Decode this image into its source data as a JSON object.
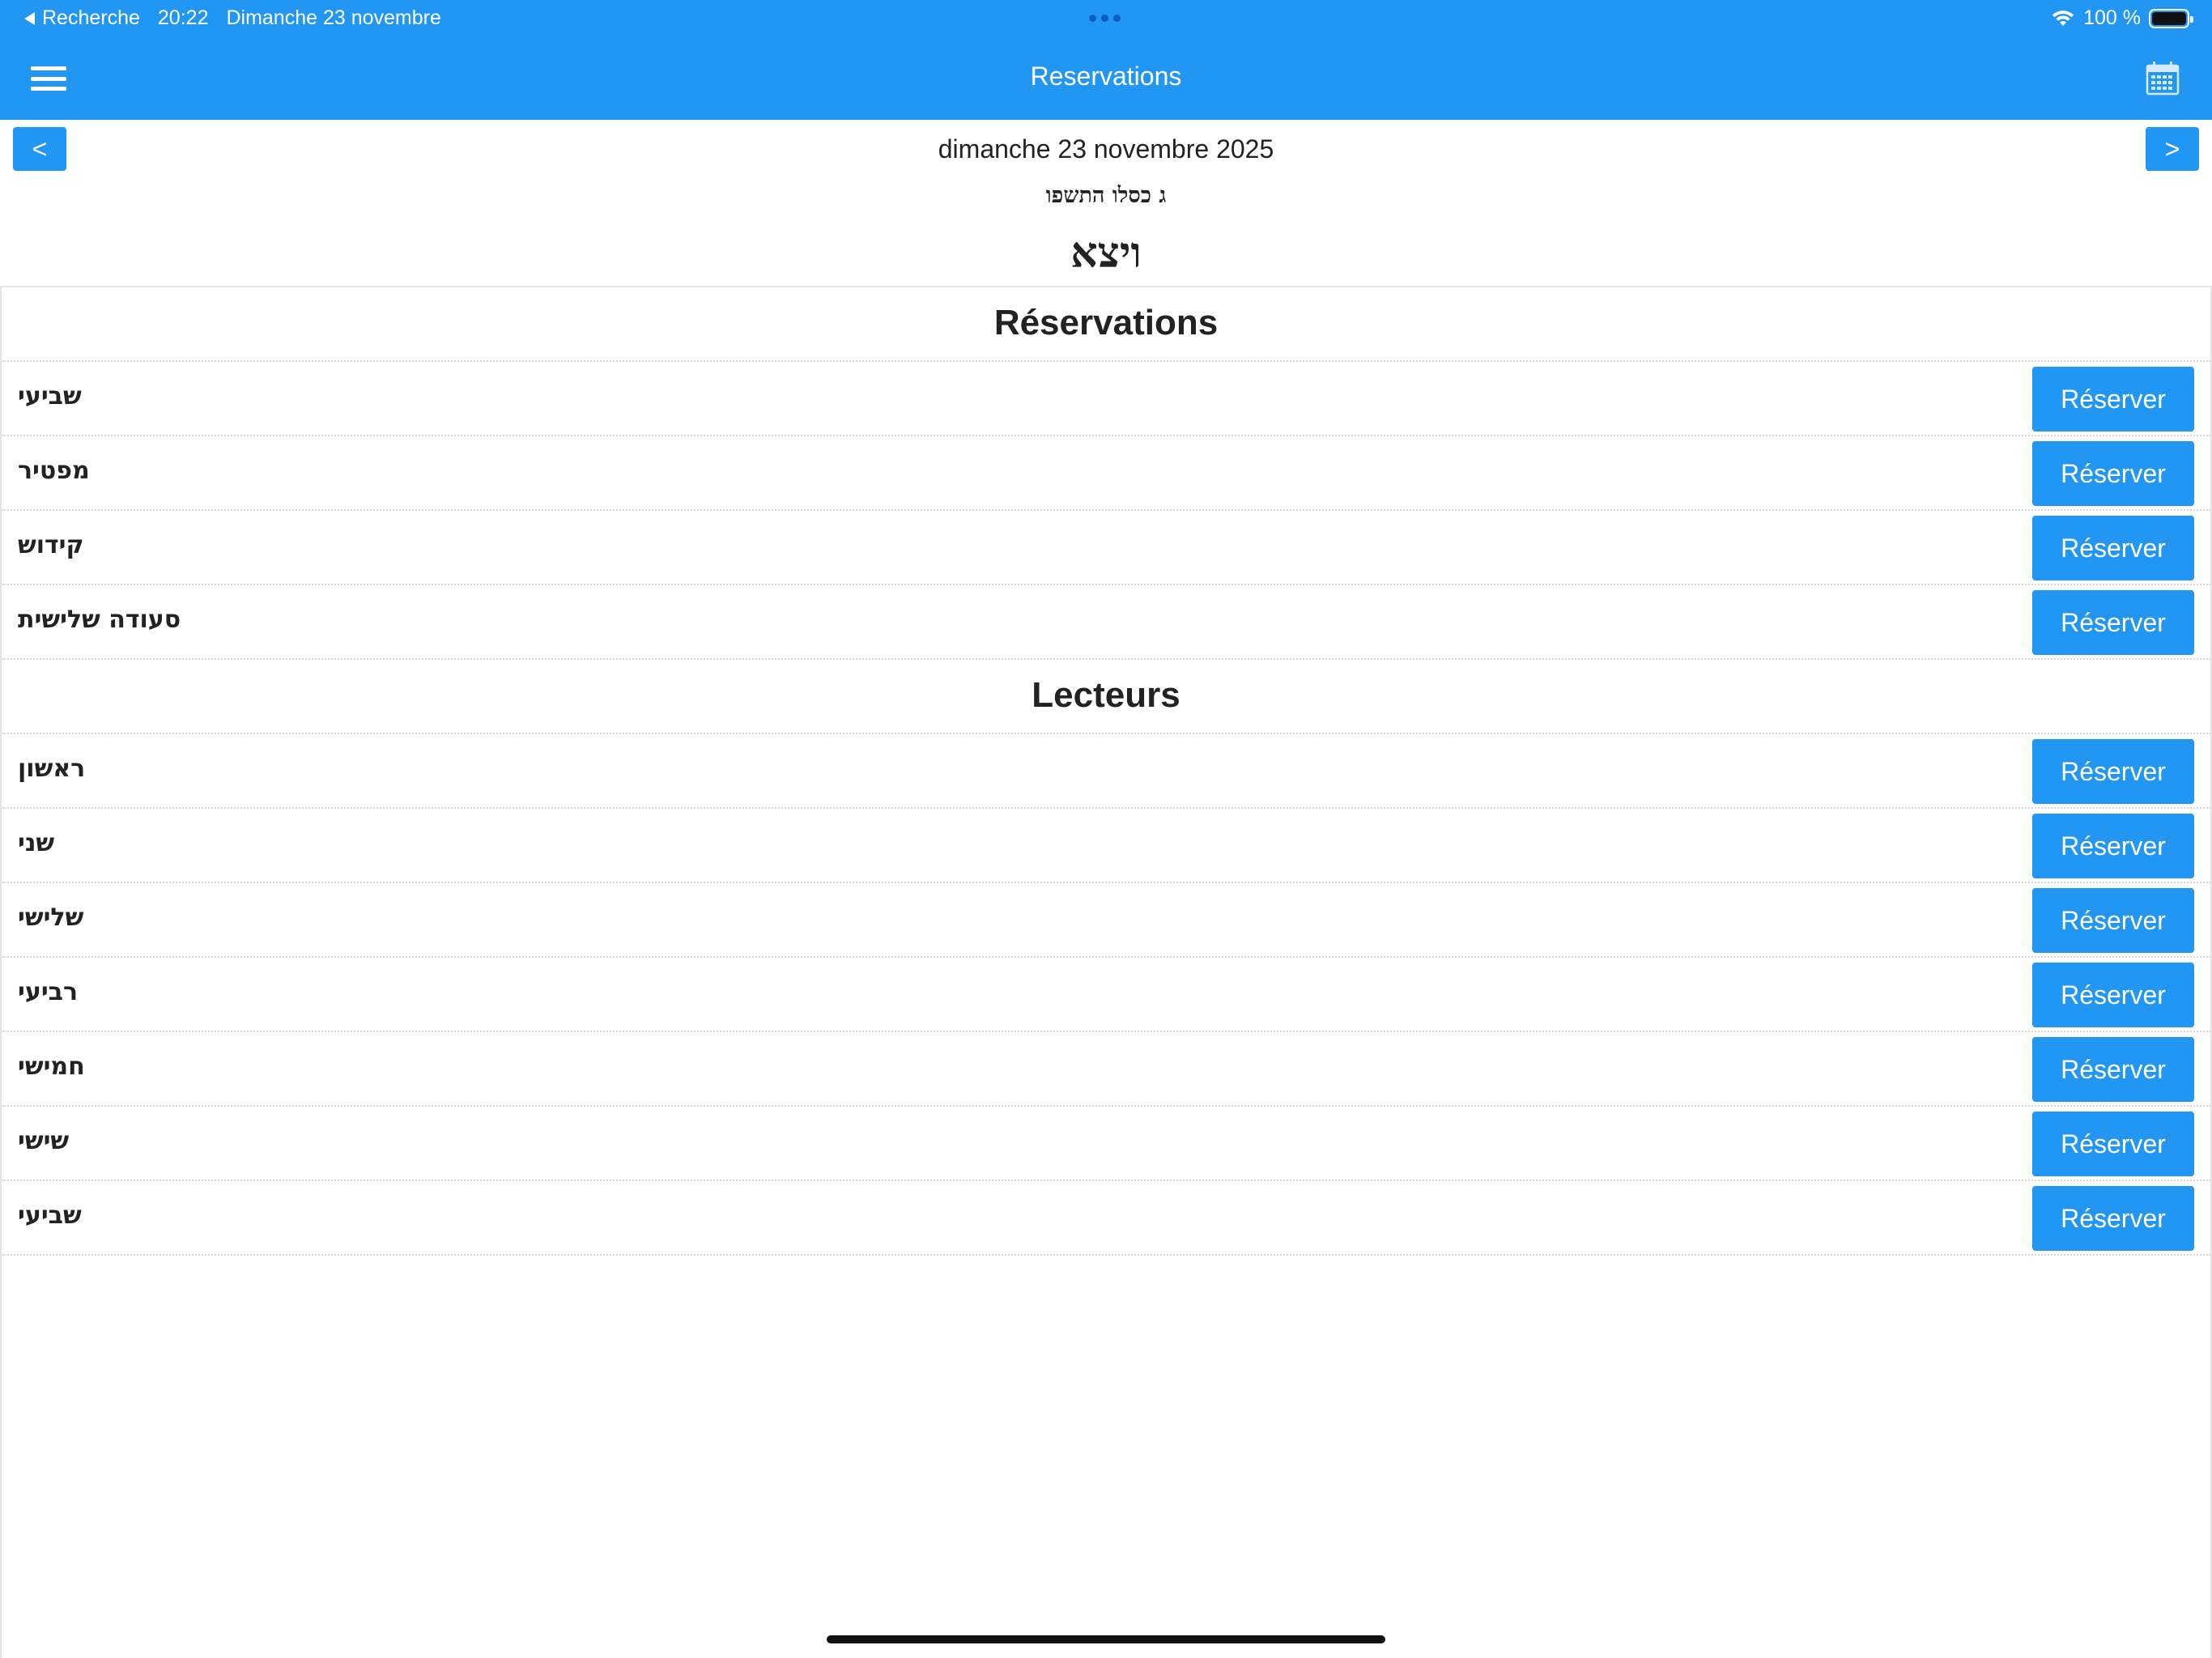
{
  "status_bar": {
    "back_label": "Recherche",
    "time": "20:22",
    "date": "Dimanche 23 novembre",
    "battery": "100 %"
  },
  "nav": {
    "title": "Reservations"
  },
  "date_header": {
    "prev": "<",
    "next": ">",
    "gregorian": "dimanche 23 novembre 2025",
    "hebrew": "ג כסלו התשפו",
    "parasha": "ויצא"
  },
  "sections": {
    "reservations": {
      "title": "Réservations",
      "items": [
        {
          "label": "שביעי",
          "button": "Réserver"
        },
        {
          "label": "מפטיר",
          "button": "Réserver"
        },
        {
          "label": "קידוש",
          "button": "Réserver"
        },
        {
          "label": "סעודה שלישית",
          "button": "Réserver"
        }
      ]
    },
    "lecteurs": {
      "title": "Lecteurs",
      "items": [
        {
          "label": "ראשון",
          "button": "Réserver"
        },
        {
          "label": "שני",
          "button": "Réserver"
        },
        {
          "label": "שלישי",
          "button": "Réserver"
        },
        {
          "label": "רביעי",
          "button": "Réserver"
        },
        {
          "label": "חמישי",
          "button": "Réserver"
        },
        {
          "label": "שישי",
          "button": "Réserver"
        },
        {
          "label": "שביעי",
          "button": "Réserver"
        }
      ]
    }
  }
}
